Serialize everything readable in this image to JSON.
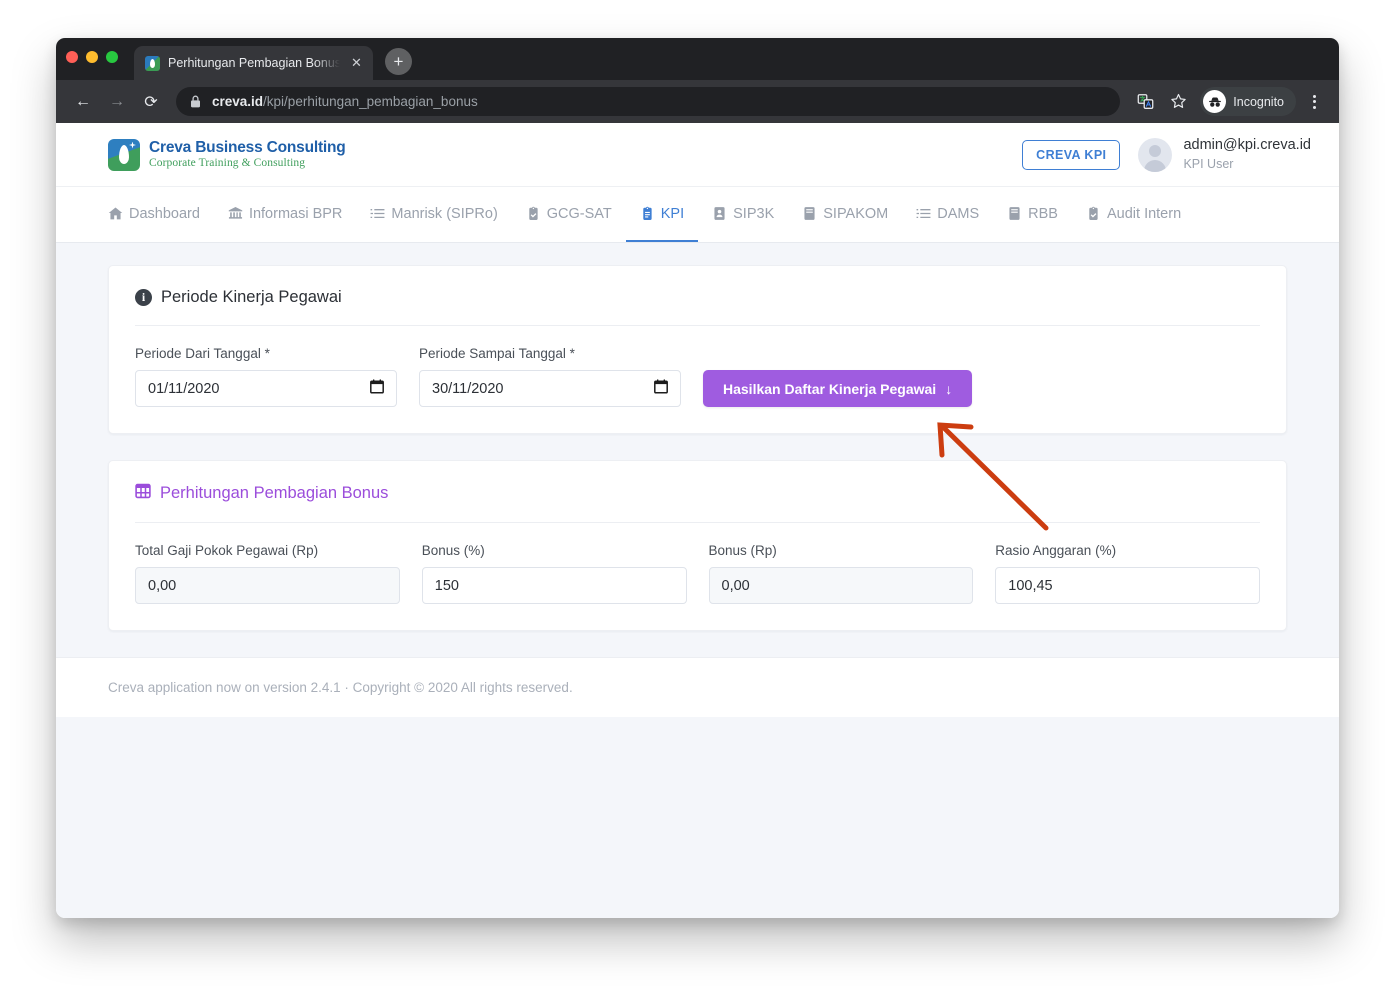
{
  "browser": {
    "tab_title": "Perhitungan Pembagian Bonus",
    "close_label": "✕",
    "new_tab_label": "+",
    "back_label": "←",
    "forward_label": "→",
    "reload_label": "⟳",
    "url_domain": "creva.id",
    "url_path": "/kpi/perhitungan_pembagian_bonus",
    "profile_label": "Incognito"
  },
  "header": {
    "logo_title": "Creva Business Consulting",
    "logo_subtitle": "Corporate Training & Consulting",
    "kpi_badge": "CREVA KPI",
    "user_email": "admin@kpi.creva.id",
    "user_role": "KPI User"
  },
  "nav": {
    "items": [
      {
        "label": "Dashboard",
        "icon": "home-icon",
        "active": false
      },
      {
        "label": "Informasi BPR",
        "icon": "bank-icon",
        "active": false
      },
      {
        "label": "Manrisk (SIPRo)",
        "icon": "list-icon",
        "active": false
      },
      {
        "label": "GCG-SAT",
        "icon": "clipboard-check-icon",
        "active": false
      },
      {
        "label": "KPI",
        "icon": "clipboard-icon",
        "active": true
      },
      {
        "label": "SIP3K",
        "icon": "id-card-icon",
        "active": false
      },
      {
        "label": "SIPAKOM",
        "icon": "book-icon",
        "active": false
      },
      {
        "label": "DAMS",
        "icon": "list-icon",
        "active": false
      },
      {
        "label": "RBB",
        "icon": "book-icon",
        "active": false
      },
      {
        "label": "Audit Intern",
        "icon": "clipboard-check-icon",
        "active": false
      }
    ]
  },
  "period_card": {
    "title": "Periode Kinerja Pegawai",
    "icon": "info-icon",
    "date_from_label": "Periode Dari Tanggal *",
    "date_from_value": "01/11/2020",
    "date_to_label": "Periode Sampai Tanggal *",
    "date_to_value": "30/11/2020",
    "generate_button": "Hasilkan Daftar Kinerja Pegawai",
    "generate_button_icon": "↓"
  },
  "bonus_card": {
    "title": "Perhitungan Pembagian Bonus",
    "icon": "calculator-icon",
    "fields": [
      {
        "label": "Total Gaji Pokok Pegawai (Rp)",
        "value": "0,00",
        "readonly": true
      },
      {
        "label": "Bonus (%)",
        "value": "150",
        "readonly": false
      },
      {
        "label": "Bonus (Rp)",
        "value": "0,00",
        "readonly": true
      },
      {
        "label": "Rasio Anggaran (%)",
        "value": "100,45",
        "readonly": false
      }
    ]
  },
  "footer": {
    "text": "Creva application now on version 2.4.1  ·  Copyright © 2020 All rights reserved."
  },
  "annotation": {
    "arrow_color": "#cc3d10"
  },
  "colors": {
    "accent_purple": "#9f5ce0",
    "accent_blue": "#3f7fd4",
    "page_bg": "#f4f6fa"
  }
}
